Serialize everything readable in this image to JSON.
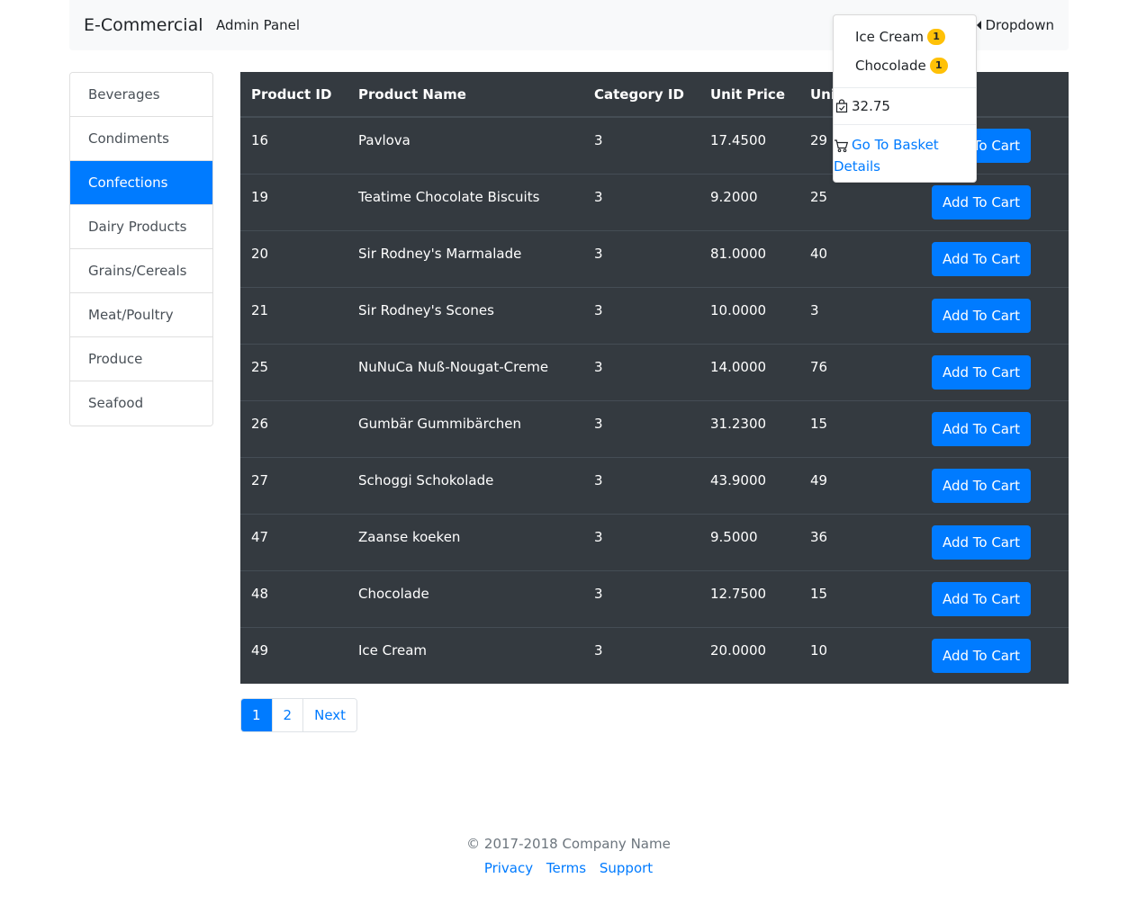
{
  "navbar": {
    "brand": "E-Commercial",
    "link": "Admin Panel",
    "dropdown_label": "Dropdown"
  },
  "categories": [
    {
      "label": "Beverages",
      "active": false
    },
    {
      "label": "Condiments",
      "active": false
    },
    {
      "label": "Confections",
      "active": true
    },
    {
      "label": "Dairy Products",
      "active": false
    },
    {
      "label": "Grains/Cereals",
      "active": false
    },
    {
      "label": "Meat/Poultry",
      "active": false
    },
    {
      "label": "Produce",
      "active": false
    },
    {
      "label": "Seafood",
      "active": false
    }
  ],
  "table": {
    "headers": [
      "Product ID",
      "Product Name",
      "Category ID",
      "Unit Price",
      "Unit"
    ],
    "button_label": "Add To Cart",
    "rows": [
      {
        "id": "16",
        "name": "Pavlova",
        "category": "3",
        "price": "17.4500",
        "stock": "29"
      },
      {
        "id": "19",
        "name": "Teatime Chocolate Biscuits",
        "category": "3",
        "price": "9.2000",
        "stock": "25"
      },
      {
        "id": "20",
        "name": "Sir Rodney's Marmalade",
        "category": "3",
        "price": "81.0000",
        "stock": "40"
      },
      {
        "id": "21",
        "name": "Sir Rodney's Scones",
        "category": "3",
        "price": "10.0000",
        "stock": "3"
      },
      {
        "id": "25",
        "name": "NuNuCa Nuß-Nougat-Creme",
        "category": "3",
        "price": "14.0000",
        "stock": "76"
      },
      {
        "id": "26",
        "name": "Gumbär Gummibärchen",
        "category": "3",
        "price": "31.2300",
        "stock": "15"
      },
      {
        "id": "27",
        "name": "Schoggi Schokolade",
        "category": "3",
        "price": "43.9000",
        "stock": "49"
      },
      {
        "id": "47",
        "name": "Zaanse koeken",
        "category": "3",
        "price": "9.5000",
        "stock": "36"
      },
      {
        "id": "48",
        "name": "Chocolade",
        "category": "3",
        "price": "12.7500",
        "stock": "15"
      },
      {
        "id": "49",
        "name": "Ice Cream",
        "category": "3",
        "price": "20.0000",
        "stock": "10"
      }
    ]
  },
  "pagination": {
    "pages": [
      "1",
      "2"
    ],
    "active_page": "1",
    "next_label": "Next"
  },
  "cart": {
    "items": [
      {
        "name": "Ice Cream",
        "qty": "1"
      },
      {
        "name": "Chocolade",
        "qty": "1"
      }
    ],
    "total": "32.75",
    "basket_link": "Go To Basket Details"
  },
  "footer": {
    "copyright": "© 2017-2018 Company Name",
    "links": [
      "Privacy",
      "Terms",
      "Support"
    ]
  },
  "colors": {
    "accent": "#007bff",
    "table_bg": "#343a40",
    "badge": "#ffc107"
  },
  "icons": {
    "total": "shopping-bag-check-icon",
    "basket": "shopping-cart-icon"
  }
}
